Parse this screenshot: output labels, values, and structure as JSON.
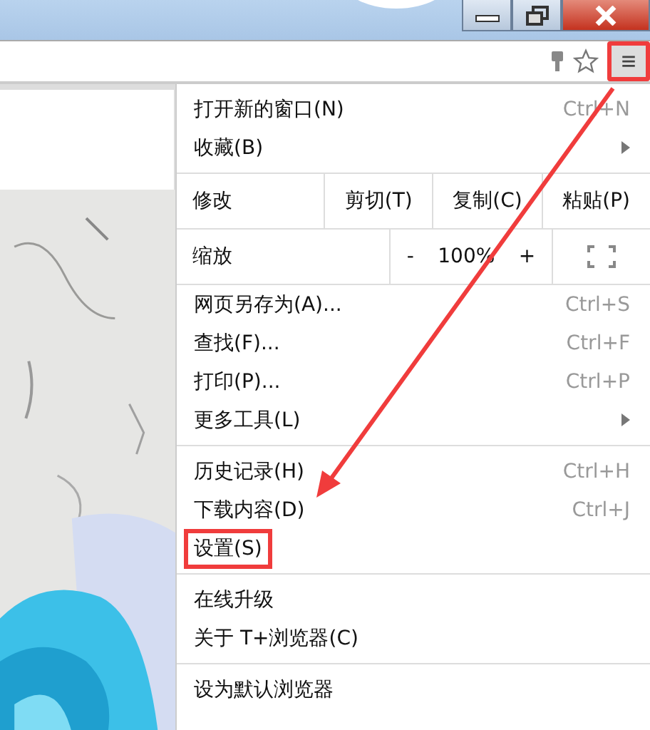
{
  "toolbar": {
    "menu_button": {
      "label": "≡",
      "marked": true
    }
  },
  "menu": [
    {
      "kind": "item",
      "label": "打开新的窗口(N)",
      "shortcut": "Ctrl+N",
      "submenu": false,
      "marked": false
    },
    {
      "kind": "item",
      "label": "收藏(B)",
      "submenu": true,
      "marked": false
    },
    {
      "kind": "separator"
    },
    {
      "kind": "edit",
      "label": "修改",
      "buttons": [
        "剪切(T)",
        "复制(C)",
        "粘贴(P)"
      ]
    },
    {
      "kind": "zoom",
      "label": "缩放",
      "minus": "-",
      "value": "100%",
      "plus": "+"
    },
    {
      "kind": "item",
      "label": "网页另存为(A)...",
      "shortcut": "Ctrl+S",
      "submenu": false,
      "marked": false
    },
    {
      "kind": "item",
      "label": "查找(F)...",
      "shortcut": "Ctrl+F",
      "submenu": false,
      "marked": false
    },
    {
      "kind": "item",
      "label": "打印(P)...",
      "shortcut": "Ctrl+P",
      "submenu": false,
      "marked": false
    },
    {
      "kind": "item",
      "label": "更多工具(L)",
      "submenu": true,
      "marked": false
    },
    {
      "kind": "separator"
    },
    {
      "kind": "item",
      "label": "历史记录(H)",
      "shortcut": "Ctrl+H",
      "submenu": false,
      "marked": false
    },
    {
      "kind": "item",
      "label": "下载内容(D)",
      "shortcut": "Ctrl+J",
      "submenu": false,
      "marked": false
    },
    {
      "kind": "item",
      "label": "设置(S)",
      "submenu": false,
      "marked": true
    },
    {
      "kind": "separator"
    },
    {
      "kind": "item",
      "label": "在线升级",
      "submenu": false,
      "marked": false
    },
    {
      "kind": "item",
      "label": "关于 T+浏览器(C)",
      "submenu": false,
      "marked": false
    },
    {
      "kind": "separator"
    },
    {
      "kind": "item",
      "label": "设为默认浏览器",
      "submenu": false,
      "marked": false
    }
  ]
}
